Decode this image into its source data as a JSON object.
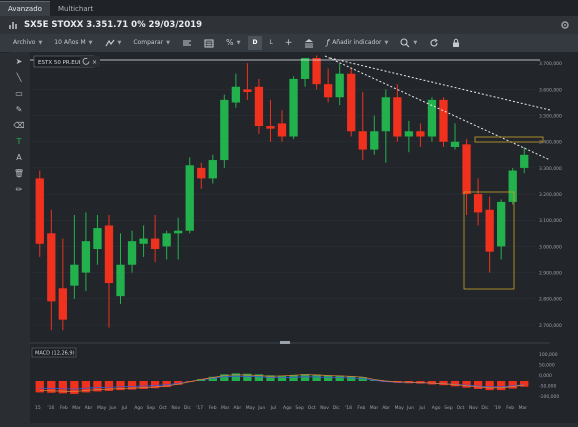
{
  "tabs": [
    {
      "label": "Avanzado"
    },
    {
      "label": "Multichart"
    }
  ],
  "title": {
    "text": "SX5E STOXX 3.351.71 0% 29/03/2019"
  },
  "toolbar": {
    "items": [
      {
        "label": "Archivo",
        "dropdown": true
      },
      {
        "label": "10 Años M",
        "dropdown": true
      },
      {
        "label": "",
        "icon": "chart-type-icon",
        "dropdown": true
      },
      {
        "label": "Comparar",
        "dropdown": true
      },
      {
        "label": "",
        "icon": "indicator-list-icon"
      },
      {
        "label": "",
        "icon": "calendar-icon"
      },
      {
        "label": "",
        "icon": "percent-icon",
        "dropdown": true
      },
      {
        "label": "D"
      },
      {
        "label": "L"
      },
      {
        "label": "",
        "icon": "crosshair-icon"
      },
      {
        "label": "",
        "icon": "bank-icon"
      },
      {
        "label": "Añadir indicador",
        "icon": "function-icon",
        "dropdown": true
      },
      {
        "label": "",
        "icon": "zoom-icon",
        "dropdown": true
      },
      {
        "label": "",
        "icon": "refresh-icon"
      },
      {
        "label": "",
        "icon": "lock-icon"
      }
    ],
    "selected": "D"
  },
  "sidebar": [
    "cursor-icon",
    "line-icon",
    "rectangle-icon",
    "brush-icon",
    "eraser-icon",
    "text-t-icon",
    "text-a-icon",
    "trash-icon",
    "pencil-icon"
  ],
  "legend": {
    "label": "ESTX 50 PR.EUR"
  },
  "colors": {
    "up": "#22b14c",
    "down": "#f0311e",
    "background": "#22262b",
    "grid": "#2e343a",
    "macd_line": "#d4803a",
    "signal_line": "#3d5bd9"
  },
  "chart_data": {
    "type": "candlestick",
    "y_axis": {
      "ticks": [
        "3.700,000",
        "3.600,000",
        "3.500,000",
        "3.400,000",
        "3.300,000",
        "3.200,000",
        "3.100,000",
        "3.000,000",
        "2.900,000",
        "2.800,000",
        "2.700,000"
      ],
      "range": [
        2650,
        3720
      ]
    },
    "x_axis": {
      "labels": [
        "15",
        "'16",
        "Feb",
        "Mar",
        "Abr",
        "May",
        "Jun",
        "Jul",
        "Ago",
        "Sep",
        "Oct",
        "Nov",
        "Dic",
        "'17",
        "Feb",
        "Mar",
        "Abr",
        "May",
        "Jun",
        "Jul",
        "Ago",
        "Sep",
        "Oct",
        "Nov",
        "Dic",
        "'18",
        "Feb",
        "Mar",
        "Abr",
        "May",
        "Jun",
        "Jul",
        "Ago",
        "Sep",
        "Oct",
        "Nov",
        "Dic",
        "'19",
        "Feb",
        "Mar"
      ]
    },
    "candles": [
      {
        "o": 3260,
        "c": 3010,
        "h": 3290,
        "l": 2960
      },
      {
        "o": 3050,
        "c": 2790,
        "h": 3140,
        "l": 2680
      },
      {
        "o": 2840,
        "c": 2720,
        "h": 3030,
        "l": 2680
      },
      {
        "o": 2850,
        "c": 2930,
        "h": 3120,
        "l": 2800
      },
      {
        "o": 2900,
        "c": 3020,
        "h": 3130,
        "l": 2830
      },
      {
        "o": 2990,
        "c": 3070,
        "h": 3120,
        "l": 2930
      },
      {
        "o": 3080,
        "c": 2860,
        "h": 3120,
        "l": 2690
      },
      {
        "o": 2810,
        "c": 2930,
        "h": 3050,
        "l": 2780
      },
      {
        "o": 2930,
        "c": 3020,
        "h": 3060,
        "l": 2900
      },
      {
        "o": 3010,
        "c": 3030,
        "h": 3080,
        "l": 2960
      },
      {
        "o": 3030,
        "c": 2990,
        "h": 3120,
        "l": 2940
      },
      {
        "o": 3000,
        "c": 3050,
        "h": 3060,
        "l": 2950
      },
      {
        "o": 3050,
        "c": 3060,
        "h": 3110,
        "l": 2950
      },
      {
        "o": 3060,
        "c": 3310,
        "h": 3340,
        "l": 3050
      },
      {
        "o": 3300,
        "c": 3260,
        "h": 3320,
        "l": 3220
      },
      {
        "o": 3260,
        "c": 3330,
        "h": 3350,
        "l": 3240
      },
      {
        "o": 3330,
        "c": 3560,
        "h": 3580,
        "l": 3300
      },
      {
        "o": 3550,
        "c": 3610,
        "h": 3660,
        "l": 3530
      },
      {
        "o": 3600,
        "c": 3590,
        "h": 3700,
        "l": 3560
      },
      {
        "o": 3610,
        "c": 3460,
        "h": 3640,
        "l": 3430
      },
      {
        "o": 3460,
        "c": 3450,
        "h": 3560,
        "l": 3400
      },
      {
        "o": 3470,
        "c": 3420,
        "h": 3520,
        "l": 3400
      },
      {
        "o": 3420,
        "c": 3640,
        "h": 3650,
        "l": 3410
      },
      {
        "o": 3640,
        "c": 3720,
        "h": 3720,
        "l": 3610
      },
      {
        "o": 3720,
        "c": 3620,
        "h": 3730,
        "l": 3600
      },
      {
        "o": 3620,
        "c": 3570,
        "h": 3680,
        "l": 3550
      },
      {
        "o": 3570,
        "c": 3660,
        "h": 3700,
        "l": 3540
      },
      {
        "o": 3660,
        "c": 3440,
        "h": 3680,
        "l": 3420
      },
      {
        "o": 3440,
        "c": 3370,
        "h": 3590,
        "l": 3330
      },
      {
        "o": 3370,
        "c": 3440,
        "h": 3500,
        "l": 3350
      },
      {
        "o": 3440,
        "c": 3570,
        "h": 3600,
        "l": 3320
      },
      {
        "o": 3570,
        "c": 3420,
        "h": 3620,
        "l": 3400
      },
      {
        "o": 3420,
        "c": 3440,
        "h": 3480,
        "l": 3360
      },
      {
        "o": 3440,
        "c": 3420,
        "h": 3470,
        "l": 3380
      },
      {
        "o": 3420,
        "c": 3560,
        "h": 3570,
        "l": 3400
      },
      {
        "o": 3560,
        "c": 3400,
        "h": 3570,
        "l": 3380
      },
      {
        "o": 3380,
        "c": 3400,
        "h": 3470,
        "l": 3370
      },
      {
        "o": 3390,
        "c": 3200,
        "h": 3410,
        "l": 3120
      },
      {
        "o": 3200,
        "c": 3130,
        "h": 3260,
        "l": 3080
      },
      {
        "o": 3140,
        "c": 2980,
        "h": 3190,
        "l": 2900
      },
      {
        "o": 3000,
        "c": 3170,
        "h": 3180,
        "l": 2950
      },
      {
        "o": 3170,
        "c": 3290,
        "h": 3300,
        "l": 3160
      },
      {
        "o": 3300,
        "c": 3350,
        "h": 3380,
        "l": 3280
      }
    ],
    "macd": {
      "label": "MACD (12,26,9)",
      "y_ticks": [
        "100,000",
        "50,000",
        "0,000",
        "-50,000",
        "-100,000"
      ],
      "histogram": [
        -60,
        -62,
        -65,
        -68,
        -60,
        -55,
        -52,
        -48,
        -45,
        -42,
        -38,
        -32,
        -20,
        -5,
        10,
        22,
        35,
        40,
        38,
        35,
        30,
        28,
        32,
        36,
        34,
        30,
        28,
        25,
        20,
        5,
        -5,
        -10,
        -12,
        -14,
        -18,
        -22,
        -28,
        -35,
        -42,
        -48,
        -48,
        -40,
        -30
      ]
    }
  }
}
